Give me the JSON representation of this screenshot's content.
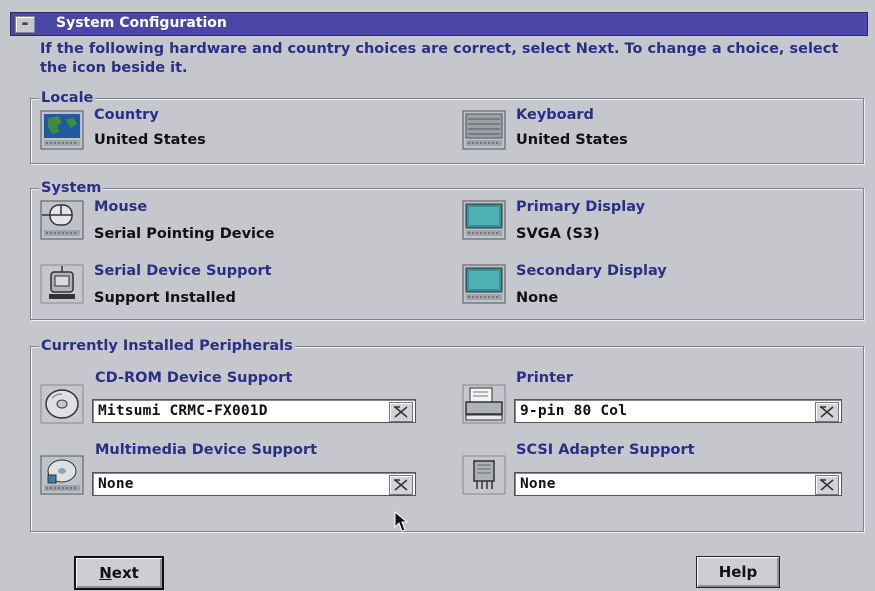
{
  "window": {
    "title": "System Configuration",
    "sysmenu_icon": "minus-icon",
    "instructions": "If the following hardware and country choices are correct, select Next. To change a choice, select the icon beside it."
  },
  "locale": {
    "label": "Locale",
    "country": {
      "label": "Country",
      "value": "United States",
      "icon": "globe-icon"
    },
    "keyboard": {
      "label": "Keyboard",
      "value": "United States",
      "icon": "keyboard-icon"
    }
  },
  "system": {
    "label": "System",
    "mouse": {
      "label": "Mouse",
      "value": "Serial Pointing Device",
      "icon": "mouse-icon"
    },
    "primary_display": {
      "label": "Primary Display",
      "value": "SVGA (S3)",
      "icon": "monitor-icon"
    },
    "serial": {
      "label": "Serial Device Support",
      "value": "Support Installed",
      "icon": "serial-port-icon"
    },
    "secondary_display": {
      "label": "Secondary Display",
      "value": "None",
      "icon": "monitor-icon"
    }
  },
  "peripherals": {
    "label": "Currently Installed Peripherals",
    "cdrom": {
      "label": "CD-ROM Device Support",
      "value": "Mitsumi CRMC-FX001D",
      "icon": "cd-icon"
    },
    "printer": {
      "label": "Printer",
      "value": "9-pin 80 Col",
      "icon": "printer-icon"
    },
    "multimedia": {
      "label": "Multimedia Device Support",
      "value": "None",
      "icon": "multimedia-icon"
    },
    "scsi": {
      "label": "SCSI Adapter Support",
      "value": "None",
      "icon": "chip-icon"
    }
  },
  "buttons": {
    "next_mnemonic": "N",
    "next_rest": "ext",
    "help": "Help"
  },
  "colors": {
    "title_bar": "#4b47a6",
    "label_text": "#2a2f86",
    "background": "#c5c7cd"
  }
}
